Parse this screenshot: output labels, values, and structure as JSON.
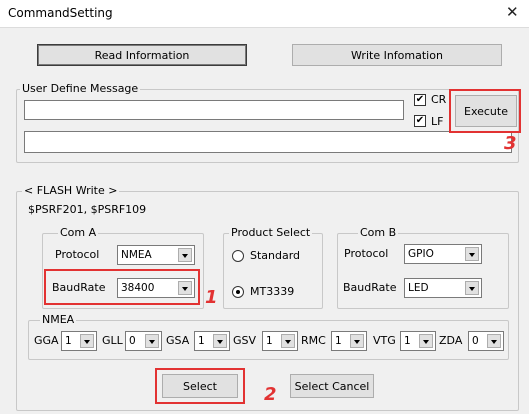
{
  "window": {
    "title": "CommandSetting",
    "close_glyph": "✕"
  },
  "toolbar": {
    "read_label": "Read Information",
    "write_label": "Write Infomation"
  },
  "user_define": {
    "group_label": "User Define Message",
    "input_value": "",
    "output_value": "",
    "cr_label": "CR",
    "cr_checked": true,
    "lf_label": "LF",
    "lf_checked": true,
    "execute_label": "Execute"
  },
  "flash": {
    "group_label": "< FLASH Write >",
    "subtitle": "$PSRF201, $PSRF109",
    "com_a": {
      "label": "Com A",
      "protocol_label": "Protocol",
      "protocol_value": "NMEA",
      "baud_label": "BaudRate",
      "baud_value": "38400"
    },
    "product": {
      "label": "Product Select",
      "options": [
        "Standard",
        "MT3339"
      ],
      "selected": "MT3339"
    },
    "com_b": {
      "label": "Com B",
      "protocol_label": "Protocol",
      "protocol_value": "GPIO",
      "baud_label": "BaudRate",
      "baud_value": "LED"
    },
    "nmea": {
      "label": "NMEA",
      "items": [
        {
          "name": "GGA",
          "value": "1"
        },
        {
          "name": "GLL",
          "value": "0"
        },
        {
          "name": "GSA",
          "value": "1"
        },
        {
          "name": "GSV",
          "value": "1"
        },
        {
          "name": "RMC",
          "value": "1"
        },
        {
          "name": "VTG",
          "value": "1"
        },
        {
          "name": "ZDA",
          "value": "0"
        }
      ]
    },
    "select_label": "Select",
    "select_cancel_label": "Select Cancel"
  },
  "annotations": {
    "one": "1",
    "two": "2",
    "three": "3"
  },
  "colors": {
    "annotation": "#e23232",
    "window_bg": "#f0f0f0"
  },
  "icons": {
    "close": "close-icon",
    "combo_arrow": "chevron-down-icon",
    "check": "checkmark-icon"
  }
}
